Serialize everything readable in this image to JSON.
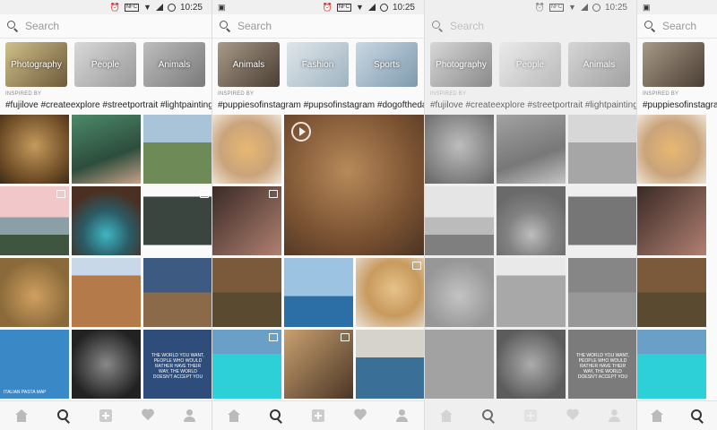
{
  "status_bar": {
    "nfc_label": "NFC",
    "time": "10:25"
  },
  "search": {
    "placeholder": "Search"
  },
  "categories": [
    {
      "label": "Photography",
      "bg": "#8a7a55"
    },
    {
      "label": "People",
      "bg": "#b8b8b8"
    },
    {
      "label": "Animals",
      "bg": "#9c9c9c"
    },
    {
      "label": "Fashion",
      "bg": "#c8d2d8"
    },
    {
      "label": "Sports",
      "bg": "#b0c4d0"
    }
  ],
  "inspired_by": {
    "label": "INSPIRED BY"
  },
  "hashtags": {
    "screen1": "#fujilove  #createexplore  #streetportrait  #lightpainting  #spicc",
    "screen2": "#puppiesofinstagram  #pupsofinstagram  #dogoftheday  #dogs"
  },
  "grid_overlay_text": "THE WORLD YOU WANT, PEOPLE WHO WOULD RATHER HAVE THEIR WAY, THE WORLD DOESN'T ACCEPT YOU",
  "map_caption": "ITALIAN PASTA MAP",
  "colors": {
    "status_bg": "#f0f0f0",
    "search_bg": "#fafafa",
    "nav_bg": "#f7f7f7",
    "tag_text": "#222222"
  },
  "nav_icons": [
    "home-icon",
    "search-icon",
    "add-icon",
    "heart-icon",
    "profile-icon"
  ]
}
